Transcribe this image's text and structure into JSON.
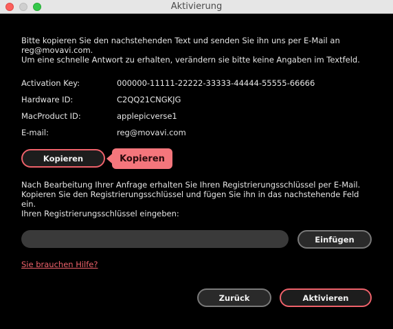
{
  "window": {
    "title": "Aktivierung"
  },
  "intro": {
    "lines": [
      "Bitte kopieren Sie den nachstehenden Text und senden Sie ihn uns per E-Mail an",
      "reg@movavi.com.",
      "Um eine schnelle Antwort zu erhalten, verändern sie bitte keine Angaben im Textfeld."
    ]
  },
  "info": [
    {
      "label": "Activation Key:",
      "value": "000000-11111-22222-33333-44444-55555-66666"
    },
    {
      "label": "Hardware ID:",
      "value": "C2QQ21CNGKJG"
    },
    {
      "label": "MacProduct ID:",
      "value": "applepicverse1"
    },
    {
      "label": "E-mail:",
      "value": "reg@movavi.com"
    }
  ],
  "copy_button": {
    "label": "Kopieren"
  },
  "tooltip": {
    "text": "Kopieren"
  },
  "instructions": {
    "lines": [
      "Nach Bearbeitung Ihrer Anfrage erhalten Sie Ihren Registrierungsschlüssel per E-Mail.",
      "Kopieren Sie den Registrierungsschlüssel und fügen Sie ihn in das nachstehende Feld",
      "ein.",
      "Ihren Registrierungsschlüssel eingeben:"
    ]
  },
  "key_field": {
    "value": "",
    "placeholder": ""
  },
  "paste_button": {
    "label": "Einfügen"
  },
  "help_link": {
    "label": "Sie brauchen Hilfe?"
  },
  "back_button": {
    "label": "Zurück"
  },
  "activate_button": {
    "label": "Aktivieren"
  },
  "colors": {
    "accent": "#f0626b",
    "background": "#000000",
    "input": "#3a3a3a"
  }
}
